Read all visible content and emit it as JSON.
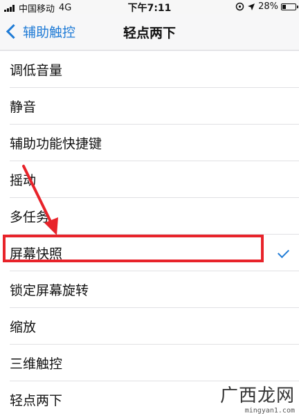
{
  "status_bar": {
    "carrier": "中国移动",
    "network": "4G",
    "time": "下午7:11",
    "battery": "28%",
    "battery_level": 0.28
  },
  "nav": {
    "back_label": "辅助触控",
    "title": "轻点两下"
  },
  "options": [
    {
      "label": "调低音量"
    },
    {
      "label": "静音"
    },
    {
      "label": "辅助功能快捷键"
    },
    {
      "label": "摇动"
    },
    {
      "label": "多任务"
    },
    {
      "label": "屏幕快照",
      "selected": true
    },
    {
      "label": "锁定屏幕旋转"
    },
    {
      "label": "缩放"
    },
    {
      "label": "三维触控"
    },
    {
      "label": "轻点两下"
    }
  ],
  "watermark": {
    "logo_text": "广西龙网",
    "url": "mingyan1.com"
  },
  "colors": {
    "accent": "#1f7bd6",
    "annotation": "#e8232a"
  }
}
